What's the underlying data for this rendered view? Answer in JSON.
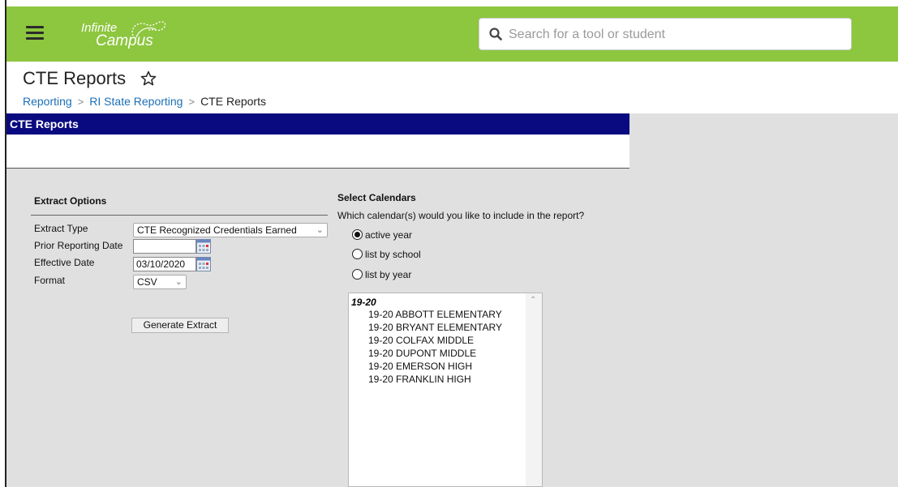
{
  "app": {
    "logo_line1": "Infinite",
    "logo_line2": "Campus",
    "menu_icon": "hamburger-menu-icon",
    "brand_color": "#8dc63f"
  },
  "search": {
    "placeholder": "Search for a tool or student",
    "icon": "search-icon"
  },
  "page": {
    "title": "CTE Reports",
    "favorite_icon": "star-outline-icon"
  },
  "breadcrumb": {
    "items": [
      "Reporting",
      "RI State Reporting",
      "CTE Reports"
    ]
  },
  "panel": {
    "header": "CTE Reports",
    "header_color": "#0a0a80"
  },
  "extract_options": {
    "title": "Extract Options",
    "extract_type_label": "Extract Type",
    "extract_type_value": "CTE Recognized Credentials Earned",
    "prior_date_label": "Prior Reporting Date",
    "prior_date_value": "",
    "effective_date_label": "Effective Date",
    "effective_date_value": "03/10/2020",
    "format_label": "Format",
    "format_value": "CSV",
    "generate_button": "Generate Extract"
  },
  "calendars": {
    "title": "Select Calendars",
    "question": "Which calendar(s) would you like to include in the report?",
    "options": [
      "active year",
      "list by school",
      "list by year"
    ],
    "selected": "active year",
    "year_group": "19-20",
    "items": [
      "19-20 ABBOTT ELEMENTARY",
      "19-20 BRYANT ELEMENTARY",
      "19-20 COLFAX MIDDLE",
      "19-20 DUPONT MIDDLE",
      "19-20 EMERSON HIGH",
      "19-20 FRANKLIN HIGH"
    ]
  }
}
